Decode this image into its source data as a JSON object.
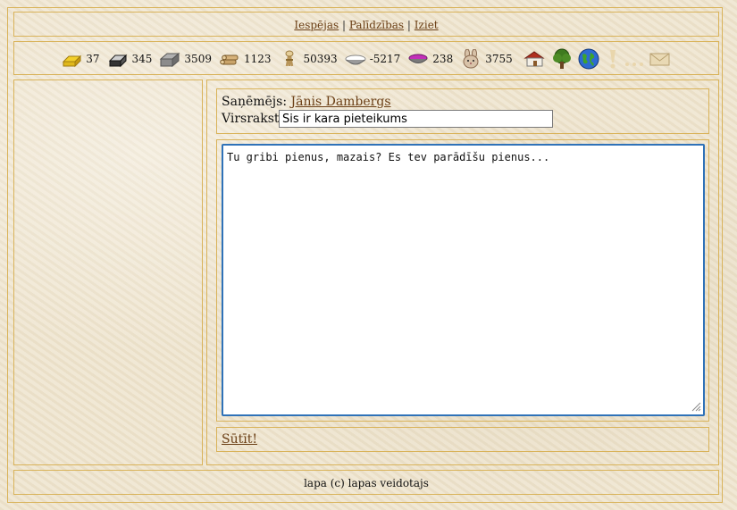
{
  "nav": {
    "links": [
      "Iespējas",
      "Palīdzības",
      "Iziet"
    ],
    "separator": "|"
  },
  "resources": [
    {
      "icon": "gold-bar-icon",
      "value": "37"
    },
    {
      "icon": "iron-bar-icon",
      "value": "345"
    },
    {
      "icon": "stone-block-icon",
      "value": "3509"
    },
    {
      "icon": "wood-logs-icon",
      "value": "1123"
    },
    {
      "icon": "wheat-sheaf-icon",
      "value": "50393"
    },
    {
      "icon": "food-bowl-icon",
      "value": "-5217"
    },
    {
      "icon": "purple-bowl-icon",
      "value": "238"
    },
    {
      "icon": "rabbit-head-icon",
      "value": "3755"
    }
  ],
  "actions": [
    "house-icon",
    "tree-icon",
    "globe-icon",
    "exclamation-icon",
    "ellipsis-icon",
    "envelope-icon"
  ],
  "message": {
    "recipient_label": "Saņēmējs:",
    "recipient_name": "Jānis Dambergs",
    "subject_label": "Virsraksts:",
    "subject_value": "Šis ir kara pieteikums",
    "body": "Tu gribi pienus, mazais? Es tev parādīšu pienus...",
    "send_label": "Sūtīt!"
  },
  "footer": {
    "text": "lapa (c) lapas veidotajs"
  },
  "colors": {
    "border": "#d9b35a",
    "link": "#6b3f16",
    "focus": "#2f72b8"
  }
}
